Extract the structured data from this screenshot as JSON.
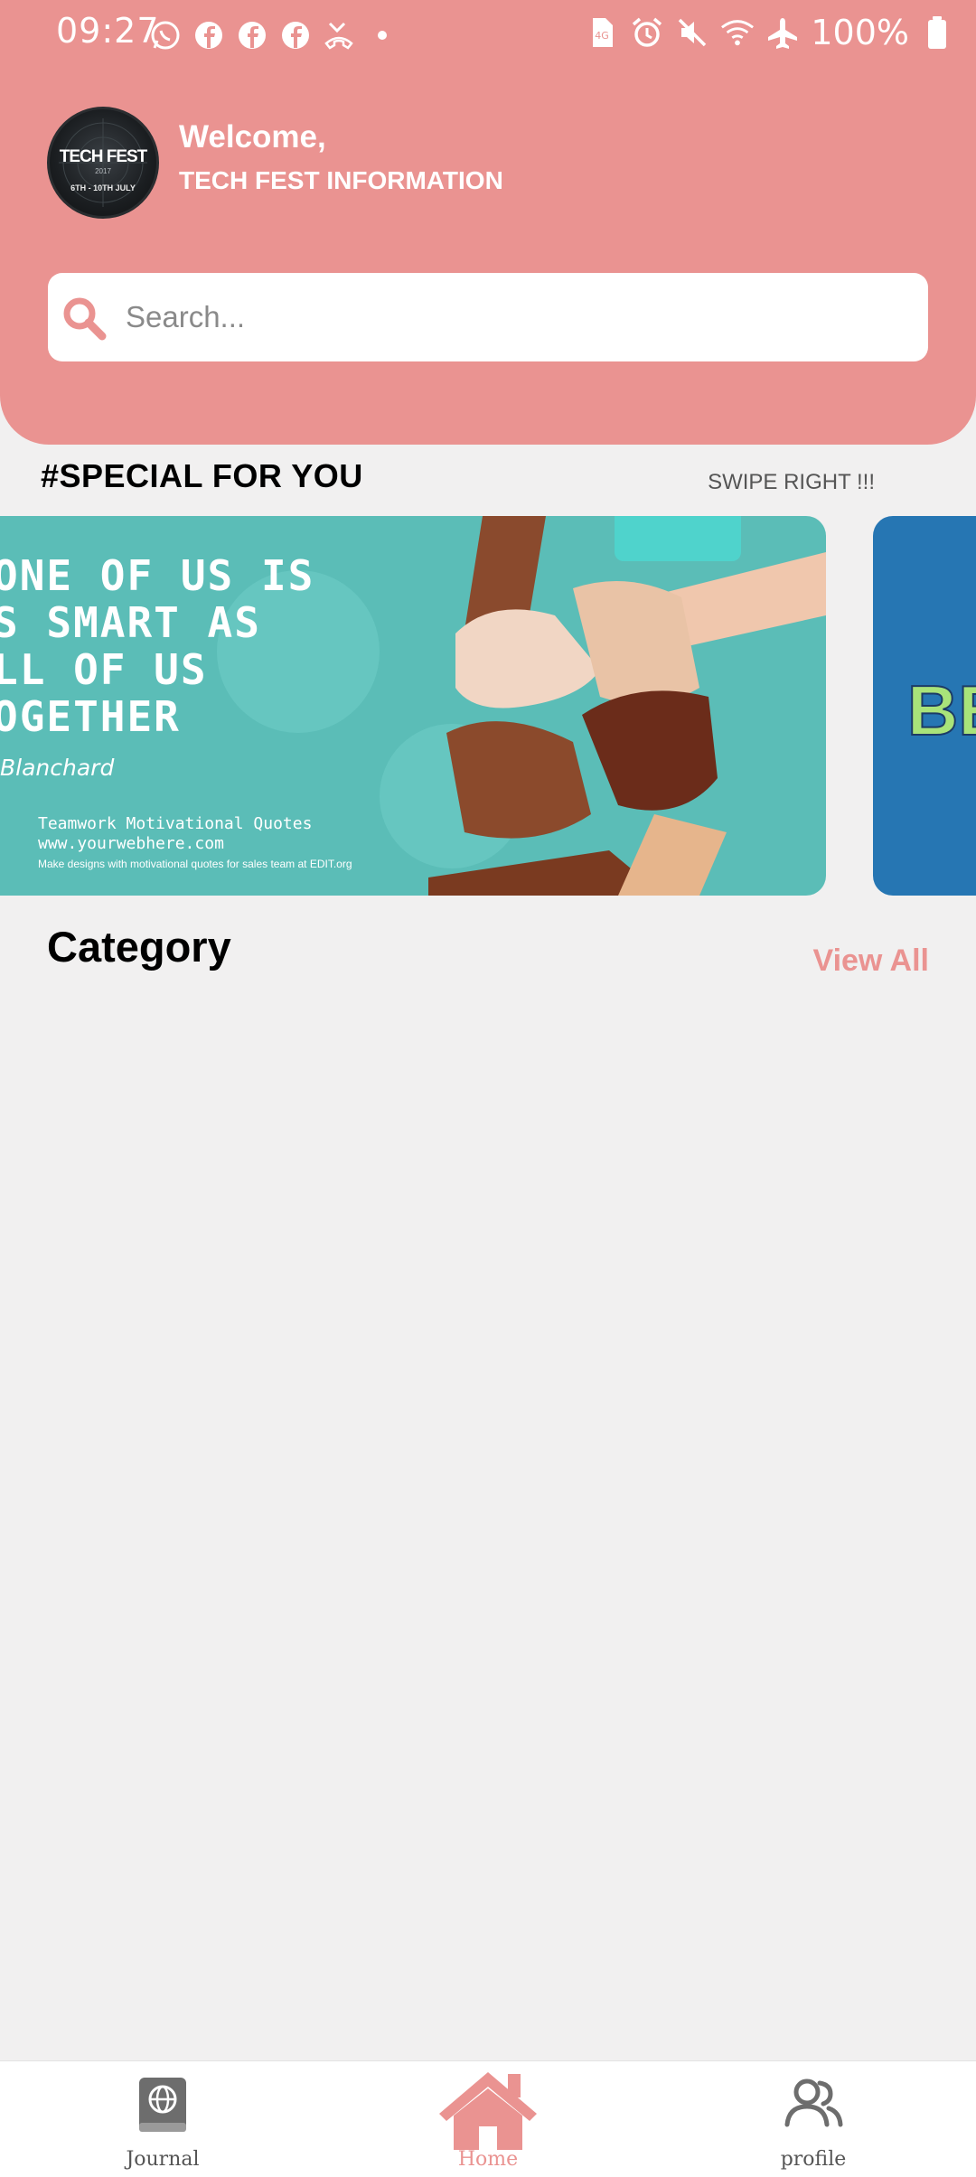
{
  "status_bar": {
    "time": "09:27",
    "battery": "100%",
    "left_icons": [
      "whatsapp-icon",
      "facebook-icon",
      "facebook-icon",
      "facebook-icon",
      "missed-call-icon",
      "dot-icon"
    ],
    "right_icons": [
      "sim-icon",
      "alarm-icon",
      "mute-icon",
      "wifi-icon",
      "airplane-icon",
      "battery-icon"
    ]
  },
  "header": {
    "avatar": {
      "title": "TECH FEST",
      "year": "2017",
      "dates": "6TH - 10TH JULY"
    },
    "welcome": "Welcome,",
    "subtitle": "TECH FEST INFORMATION",
    "search_placeholder": "Search..."
  },
  "special": {
    "title": "#SPECIAL FOR YOU",
    "swipe_hint": "SWIPE RIGHT !!!",
    "banner": {
      "quote_lines": [
        "ONE OF US IS",
        "S SMART AS",
        "LL OF US",
        "OGETHER"
      ],
      "author": "Blanchard",
      "caption_line1": "Teamwork Motivational Quotes",
      "caption_line2": "www.yourwebhere.com",
      "caption_small": "Make designs with motivational quotes for sales team at EDIT.org"
    },
    "banner2_text": "BE"
  },
  "category": {
    "title": "Category",
    "view_all": "View All"
  },
  "bottom_nav": {
    "journal": "Journal",
    "home": "Home",
    "profile": "profile"
  },
  "colors": {
    "primary": "#ea9391",
    "banner_teal": "#5bbdb7",
    "banner_blue": "#2676b3",
    "background": "#f1f0f0"
  }
}
